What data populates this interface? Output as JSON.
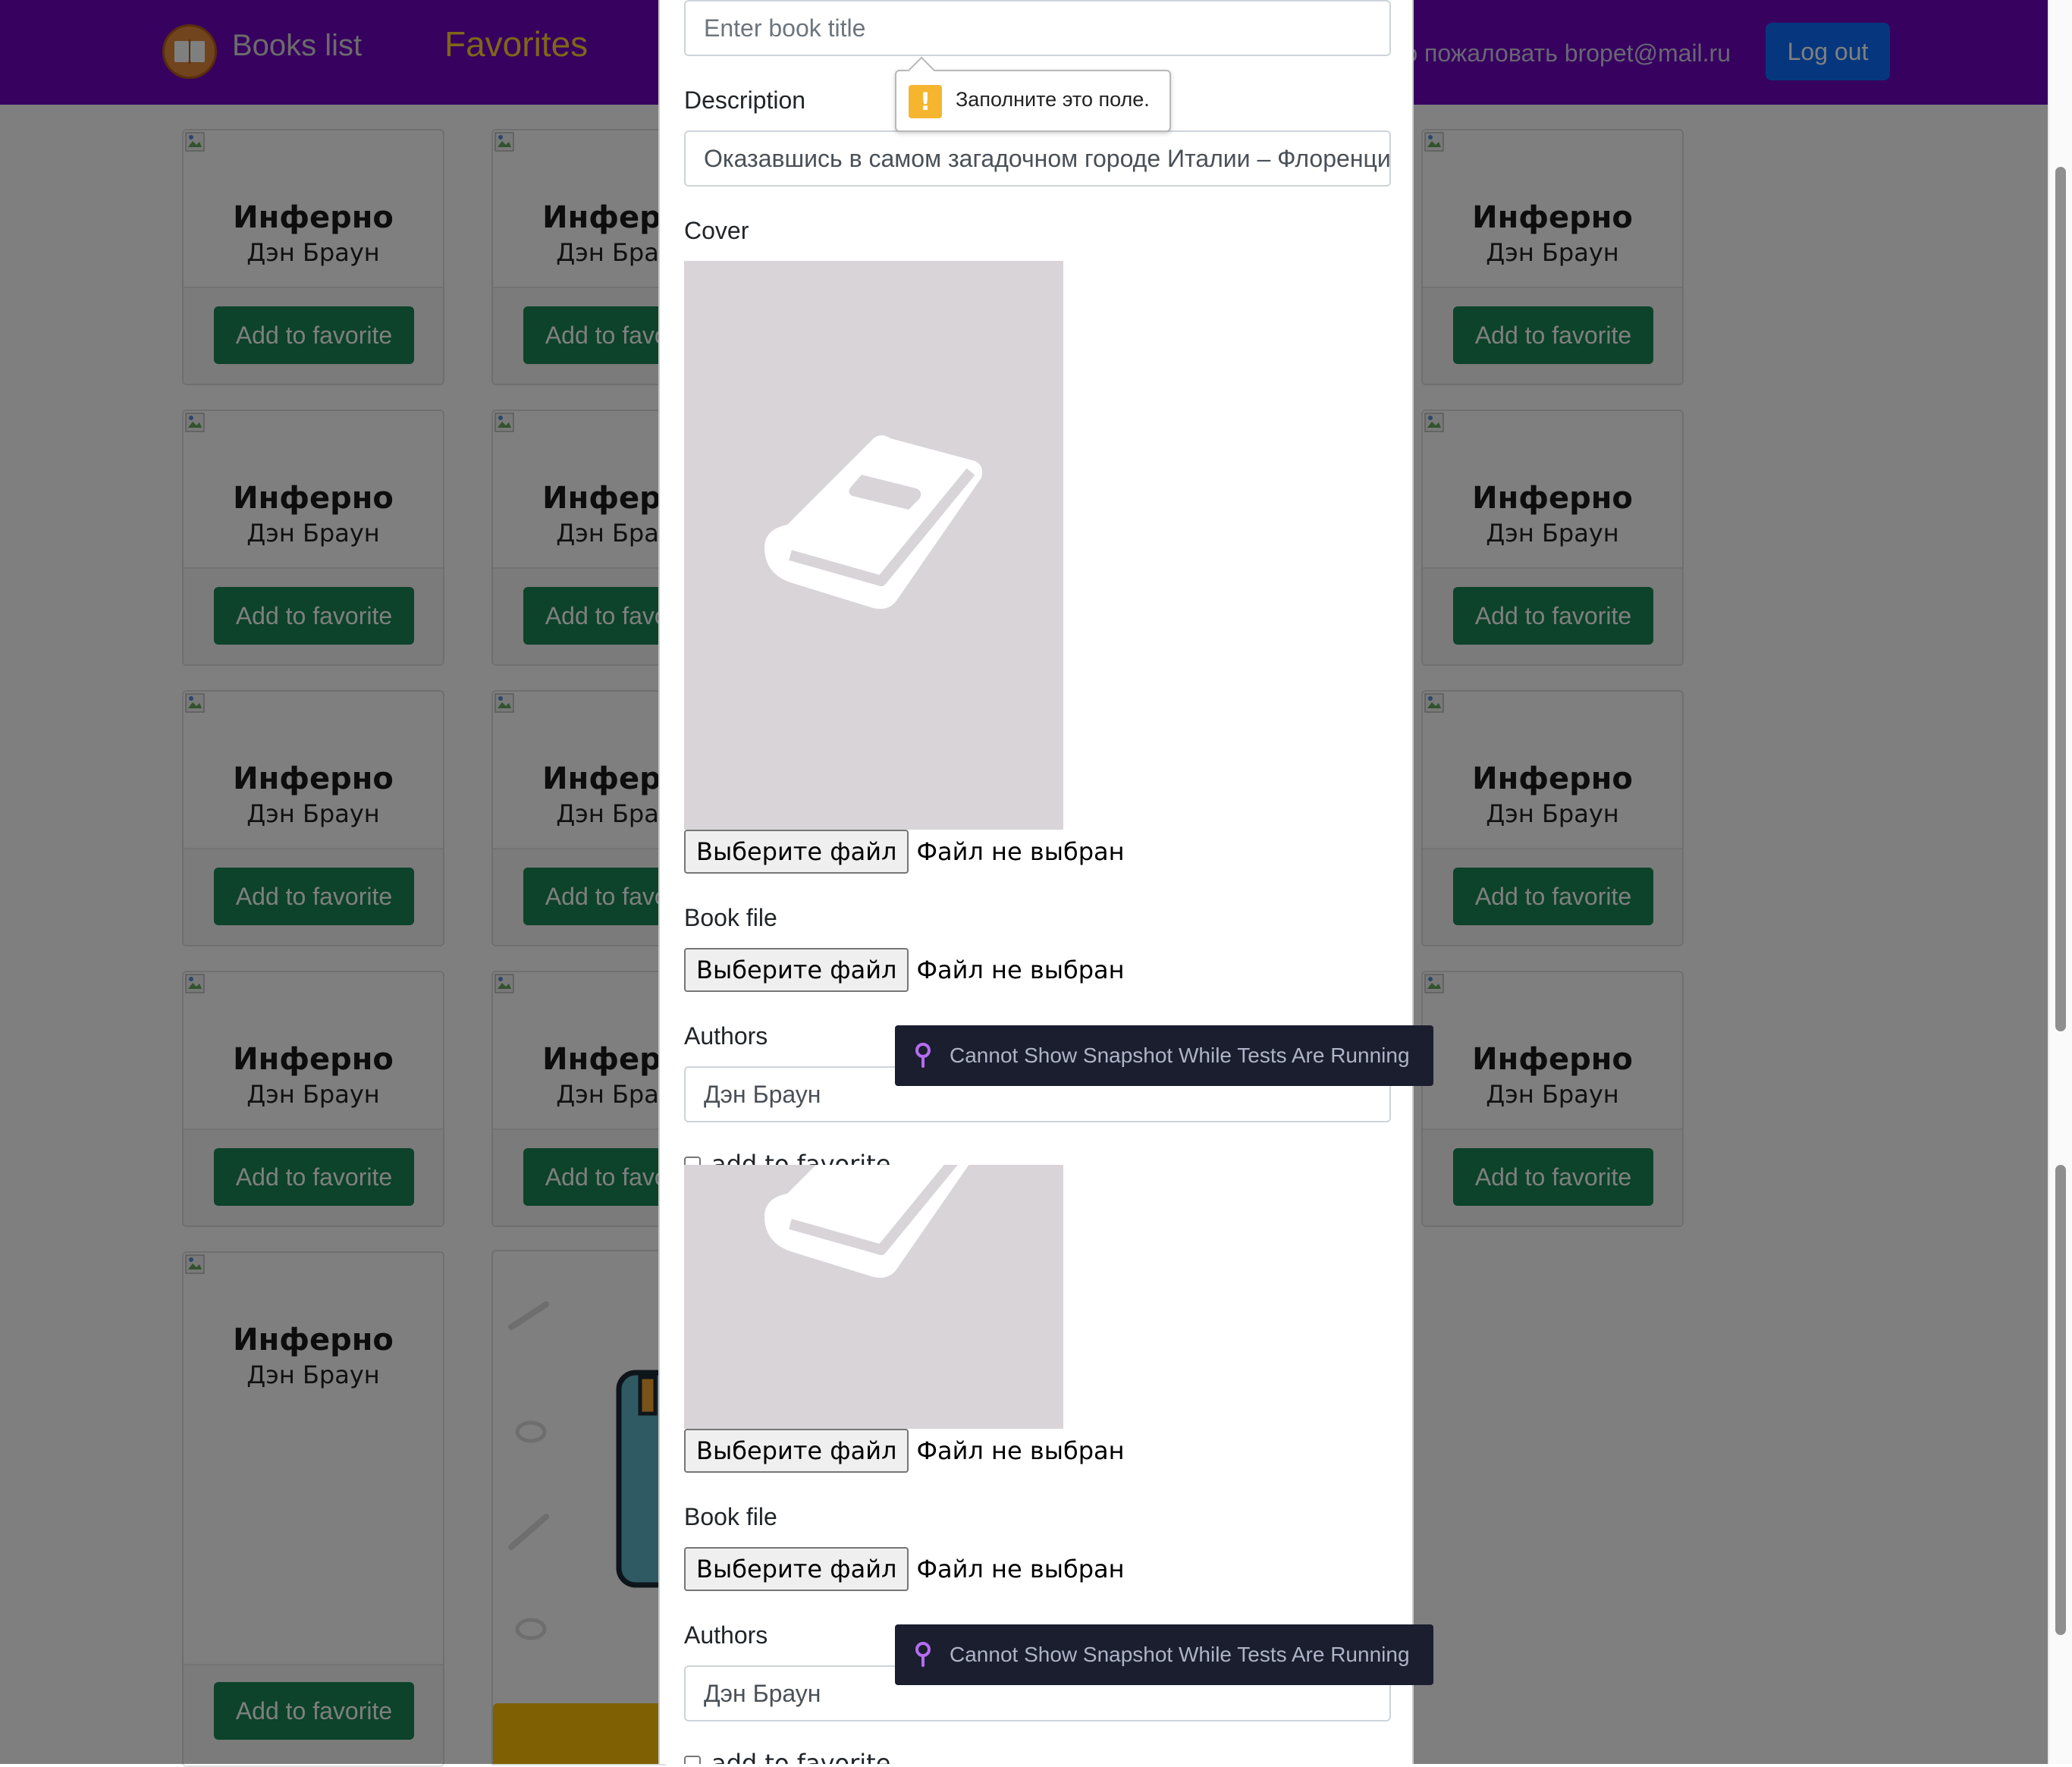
{
  "navbar": {
    "books_list": "Books list",
    "favorites": "Favorites",
    "welcome": "Добро пожаловать bropet@mail.ru",
    "logout": "Log out"
  },
  "card": {
    "title": "Инферно",
    "author": "Дэн Браун",
    "button": "Add to favorite"
  },
  "modal": {
    "title_placeholder": "Enter book title",
    "description_label": "Description",
    "description_value": "Оказавшись в самом загадочном городе Италии – Флоренции, профессор Лэнгдон",
    "cover_label": "Cover",
    "file_button": "Выберите файл",
    "file_none": "Файл не выбран",
    "book_file_label": "Book file",
    "authors_label": "Authors",
    "authors_value": "Дэн Браун",
    "favorite_checkbox": "add to favorite"
  },
  "validation": {
    "message": "Заполните это поле."
  },
  "snapshot": {
    "message": "Cannot Show Snapshot While Tests Are Running"
  },
  "colors": {
    "navbar": "#6f02bf",
    "favorites_link": "#ffcc33",
    "success_button": "#198754",
    "primary_button": "#0d6efd"
  },
  "icons": [
    "books-logo-icon",
    "broken-image-icon",
    "book-placeholder-icon",
    "warning-icon",
    "pin-icon"
  ]
}
